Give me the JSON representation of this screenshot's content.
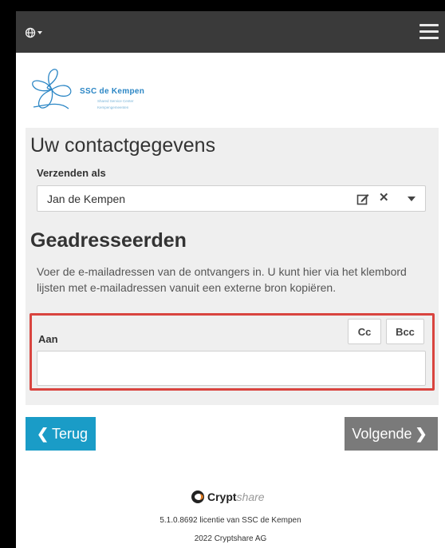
{
  "brand": {
    "name": "SSC de Kempen",
    "subtitle_1": "Shared Service Center",
    "subtitle_2": "Kempengemeenten",
    "logo_color": "#2b86c5"
  },
  "navbar": {
    "language_icon": "globe-icon",
    "menu_icon": "hamburger-icon"
  },
  "contact": {
    "heading": "Uw contactgegevens",
    "send_as_label": "Verzenden als",
    "send_as_value": "Jan de Kempen",
    "icons": [
      "edit-icon",
      "clear-icon",
      "caret-down-icon"
    ]
  },
  "recipients": {
    "heading": "Geadresseerden",
    "description": "Voer de e-mailadressen van de ontvangers in. U kunt hier via het klembord lijsten met e-mailadressen vanuit een externe bron kopiëren.",
    "to_label": "Aan",
    "cc_label": "Cc",
    "bcc_label": "Bcc",
    "to_value": "",
    "highlight_color": "#d9443f"
  },
  "navigation": {
    "back_label": "Terug",
    "next_label": "Volgende",
    "back_color": "#1a9cc7",
    "next_color": "#7a7a7a"
  },
  "footer": {
    "product_bold": "Crypt",
    "product_italic": "share",
    "license": "5.1.0.8692 licentie van SSC de Kempen",
    "copyright": "2022 Cryptshare AG"
  }
}
